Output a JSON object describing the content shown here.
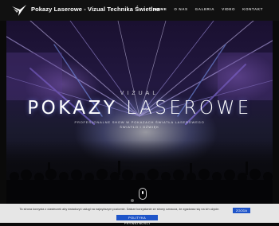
{
  "header": {
    "brand": "Pokazy Laserowe - Vizual Technika Świetlna",
    "logo_icon": "bird-wing-logo-icon",
    "nav": [
      "HOME",
      "O NAS",
      "GALERIA",
      "VIDEO",
      "KONTAKT"
    ],
    "nav_active": "HOME"
  },
  "hero": {
    "subtitle": "VIZUAL",
    "title_part1": "POKAZY",
    "title_part2": "LASEROWE",
    "tagline_line1": "PROFESJONALNE SHOW W POKAZACH ŚWIATŁA LASEROWEGO",
    "tagline_line2": "ŚWIATŁO I DŹWIĘK",
    "scroll_icon": "mouse-scroll-icon"
  },
  "cookie": {
    "text": "Ta strona korzysta z ciasteczek aby świadczyć usługi na najwyższym poziomie. Dalsze korzystanie ze strony oznacza, że zgadzasz się na ich użycie.",
    "ok_label": "ZGODA",
    "policy_label": "POLITYKA PRYWATNOŚCI"
  },
  "colors": {
    "header_bg": "#111111",
    "accent_button": "#1f55c9",
    "cookie_bg": "#e6e6e6"
  }
}
